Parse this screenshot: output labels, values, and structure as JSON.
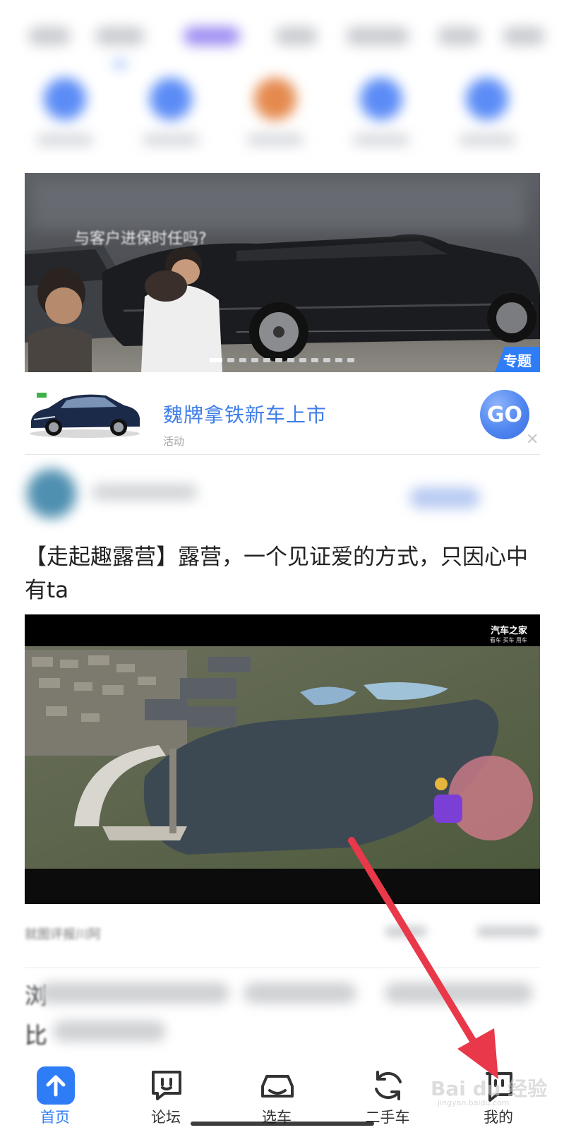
{
  "banner": {
    "title_partial": "与客户进保时任吗?",
    "tag": "专题",
    "dots_count": 12,
    "active_dot": 0
  },
  "promo": {
    "title": "魏牌拿铁新车上市",
    "subtitle": "活动",
    "go_label": "GO",
    "close": "✕"
  },
  "article": {
    "title": "【走起趣露营】露营，一个见证爱的方式，只因心中有ta",
    "video_watermark": "汽车之家",
    "video_watermark_sub": "看车 买车 用车",
    "meta_partial": "就图评报川阿"
  },
  "next_article": {
    "first_char": "浏",
    "second_line_start": "比"
  },
  "bottom_nav": {
    "items": [
      {
        "label": "首页",
        "icon": "home-arrow-icon",
        "active": true
      },
      {
        "label": "论坛",
        "icon": "forum-chat-icon",
        "active": false
      },
      {
        "label": "选车",
        "icon": "car-select-icon",
        "active": false
      },
      {
        "label": "二手车",
        "icon": "used-car-refresh-icon",
        "active": false
      },
      {
        "label": "我的",
        "icon": "profile-face-icon",
        "active": false
      }
    ]
  },
  "watermark": {
    "text": "Bai du 经验",
    "sub": "jingyan.baidu.com"
  },
  "colors": {
    "accent": "#2f7df6",
    "arrow": "#e8384a"
  }
}
